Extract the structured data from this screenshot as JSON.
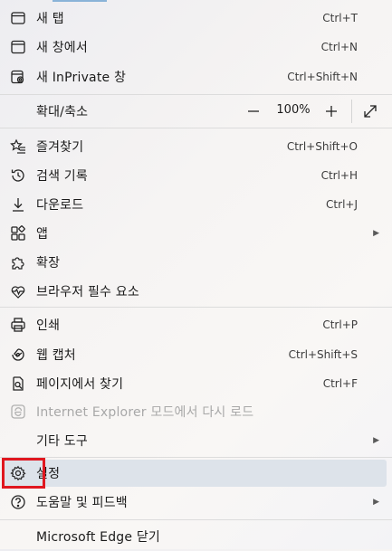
{
  "menu": {
    "new_tab": {
      "label": "새 탭",
      "shortcut": "Ctrl+T",
      "icon": "new-tab-icon"
    },
    "new_window": {
      "label": "새 창에서",
      "shortcut": "Ctrl+N",
      "icon": "window-icon"
    },
    "inprivate": {
      "label": "새 InPrivate 창",
      "shortcut": "Ctrl+Shift+N",
      "icon": "inprivate-icon"
    },
    "zoom": {
      "label": "확대/축소",
      "minus": "—",
      "value": "100%",
      "plus": "+",
      "fullscreen_icon": "fullscreen-icon"
    },
    "favorites": {
      "label": "즐겨찾기",
      "shortcut": "Ctrl+Shift+O",
      "icon": "star-list-icon"
    },
    "history": {
      "label": "검색 기록",
      "shortcut": "Ctrl+H",
      "icon": "history-icon"
    },
    "downloads": {
      "label": "다운로드",
      "shortcut": "Ctrl+J",
      "icon": "download-icon"
    },
    "apps": {
      "label": "앱",
      "arrow": "▶",
      "icon": "apps-icon"
    },
    "extensions": {
      "label": "확장",
      "icon": "puzzle-icon"
    },
    "essentials": {
      "label": "브라우저 필수 요소",
      "icon": "heartbeat-icon"
    },
    "print": {
      "label": "인쇄",
      "shortcut": "Ctrl+P",
      "icon": "printer-icon"
    },
    "web_capture": {
      "label": "웹 캡처",
      "shortcut": "Ctrl+Shift+S",
      "icon": "capture-icon"
    },
    "find": {
      "label": "페이지에서 찾기",
      "shortcut": "Ctrl+F",
      "icon": "find-icon"
    },
    "ie_mode": {
      "label": "Internet Explorer 모드에서 다시 로드",
      "icon": "ie-icon"
    },
    "more_tools": {
      "label": "기타 도구",
      "arrow": "▶"
    },
    "settings": {
      "label": "설정",
      "icon": "gear-icon"
    },
    "help": {
      "label": "도움말 및 피드백",
      "arrow": "▶",
      "icon": "help-icon"
    },
    "close_edge": {
      "label": "Microsoft Edge 닫기"
    }
  },
  "colors": {
    "highlight": "#dde3ea",
    "annotation": "#e0171f"
  }
}
